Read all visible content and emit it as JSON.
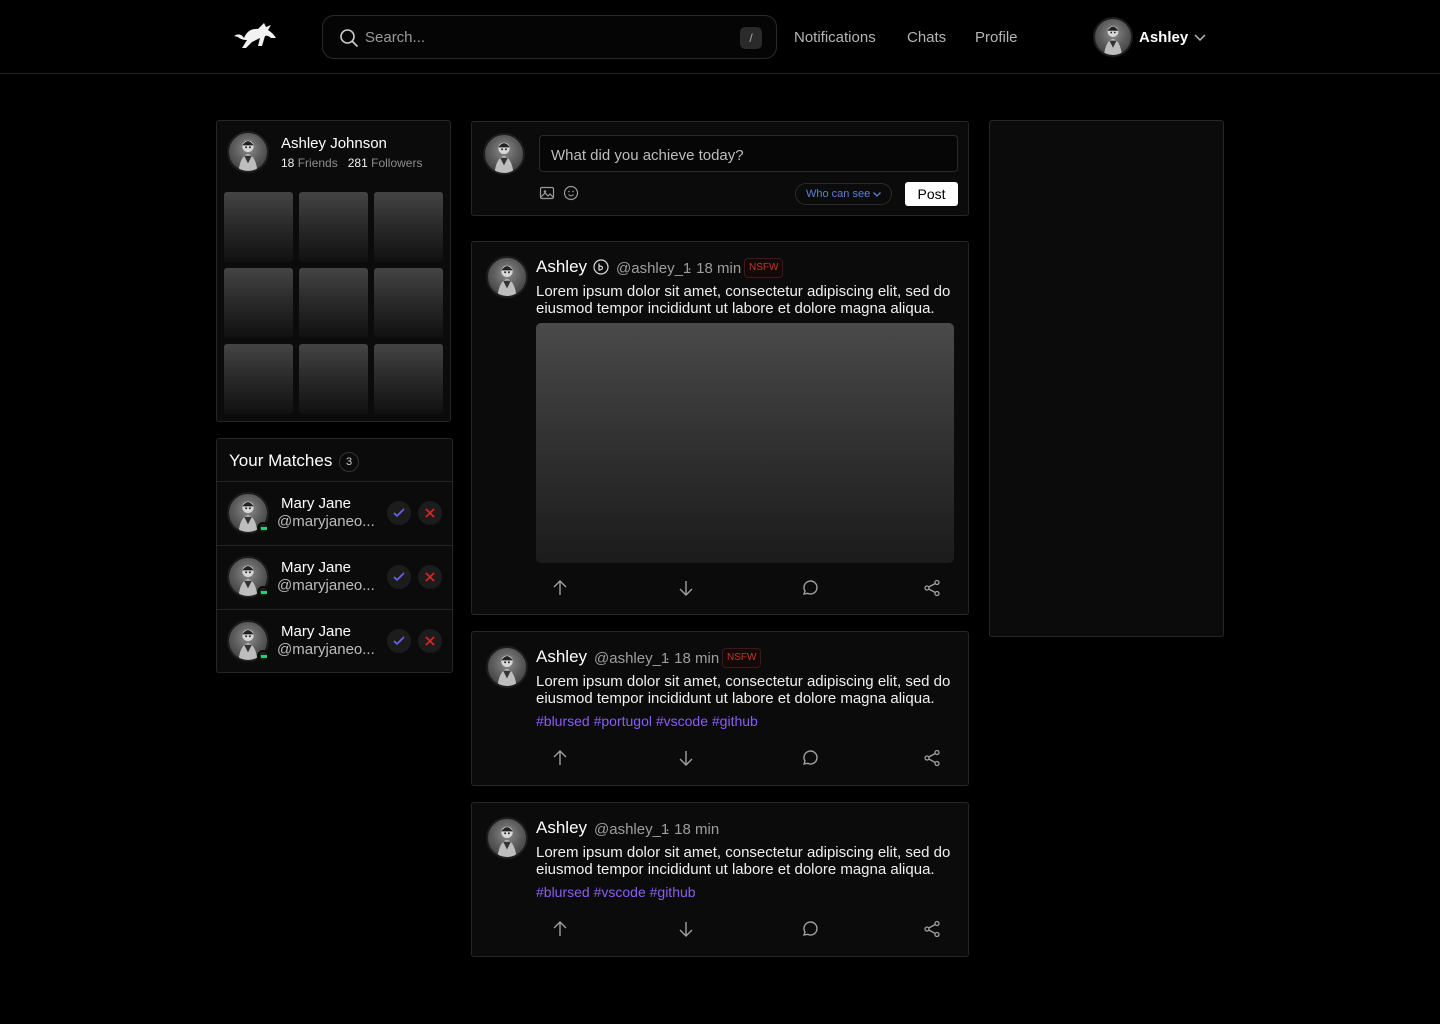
{
  "header": {
    "search_placeholder": "Search...",
    "search_shortcut": "/",
    "nav": [
      "Notifications",
      "Chats",
      "Profile"
    ],
    "user_name": "Ashley"
  },
  "profile": {
    "name": "Ashley Johnson",
    "friends_count": "18",
    "friends_label": "Friends",
    "followers_count": "281",
    "followers_label": "Followers"
  },
  "matches": {
    "title": "Your Matches",
    "count": "3",
    "items": [
      {
        "name": "Mary Jane",
        "handle": "@maryjaneo..."
      },
      {
        "name": "Mary Jane",
        "handle": "@maryjaneo..."
      },
      {
        "name": "Mary Jane",
        "handle": "@maryjaneo..."
      }
    ]
  },
  "composer": {
    "placeholder": "What did you achieve today?",
    "who_can_see": "Who can see",
    "post_label": "Post"
  },
  "posts": [
    {
      "name": "Ashley",
      "handle": "@ashley_1",
      "time": "· 18 min",
      "badge": "NSFW",
      "text": "Lorem ipsum dolor sit amet, consectetur adipiscing elit, sed do eiusmod tempor incididunt ut labore et dolore magna aliqua."
    },
    {
      "name": "Ashley",
      "handle": "@ashley_1",
      "time": "· 18 min",
      "badge": "NSFW",
      "text": "Lorem ipsum dolor sit amet, consectetur adipiscing elit, sed do eiusmod tempor incididunt ut labore et dolore magna aliqua.",
      "tags": "#blursed #portugol #vscode #github"
    },
    {
      "name": "Ashley",
      "handle": "@ashley_1",
      "time": "· 18 min",
      "text": "Lorem ipsum dolor sit amet, consectetur adipiscing elit, sed do eiusmod tempor incididunt ut labore et dolore magna aliqua.",
      "tags": "#blursed #vscode #github"
    }
  ],
  "colors": {
    "background": "#000000",
    "hashtag": "#8b5cf6",
    "nsfw": "#c0392b",
    "accept": "#6366f1",
    "reject": "#dc2626",
    "online": "#2ecc71",
    "who_can_see": "#5b7fd6"
  },
  "icons": [
    "logo-icon",
    "search-icon",
    "chevron-down-icon",
    "image-icon",
    "emoji-icon",
    "verified-icon",
    "check-icon",
    "close-icon",
    "upvote-icon",
    "downvote-icon",
    "comment-icon",
    "share-icon"
  ]
}
